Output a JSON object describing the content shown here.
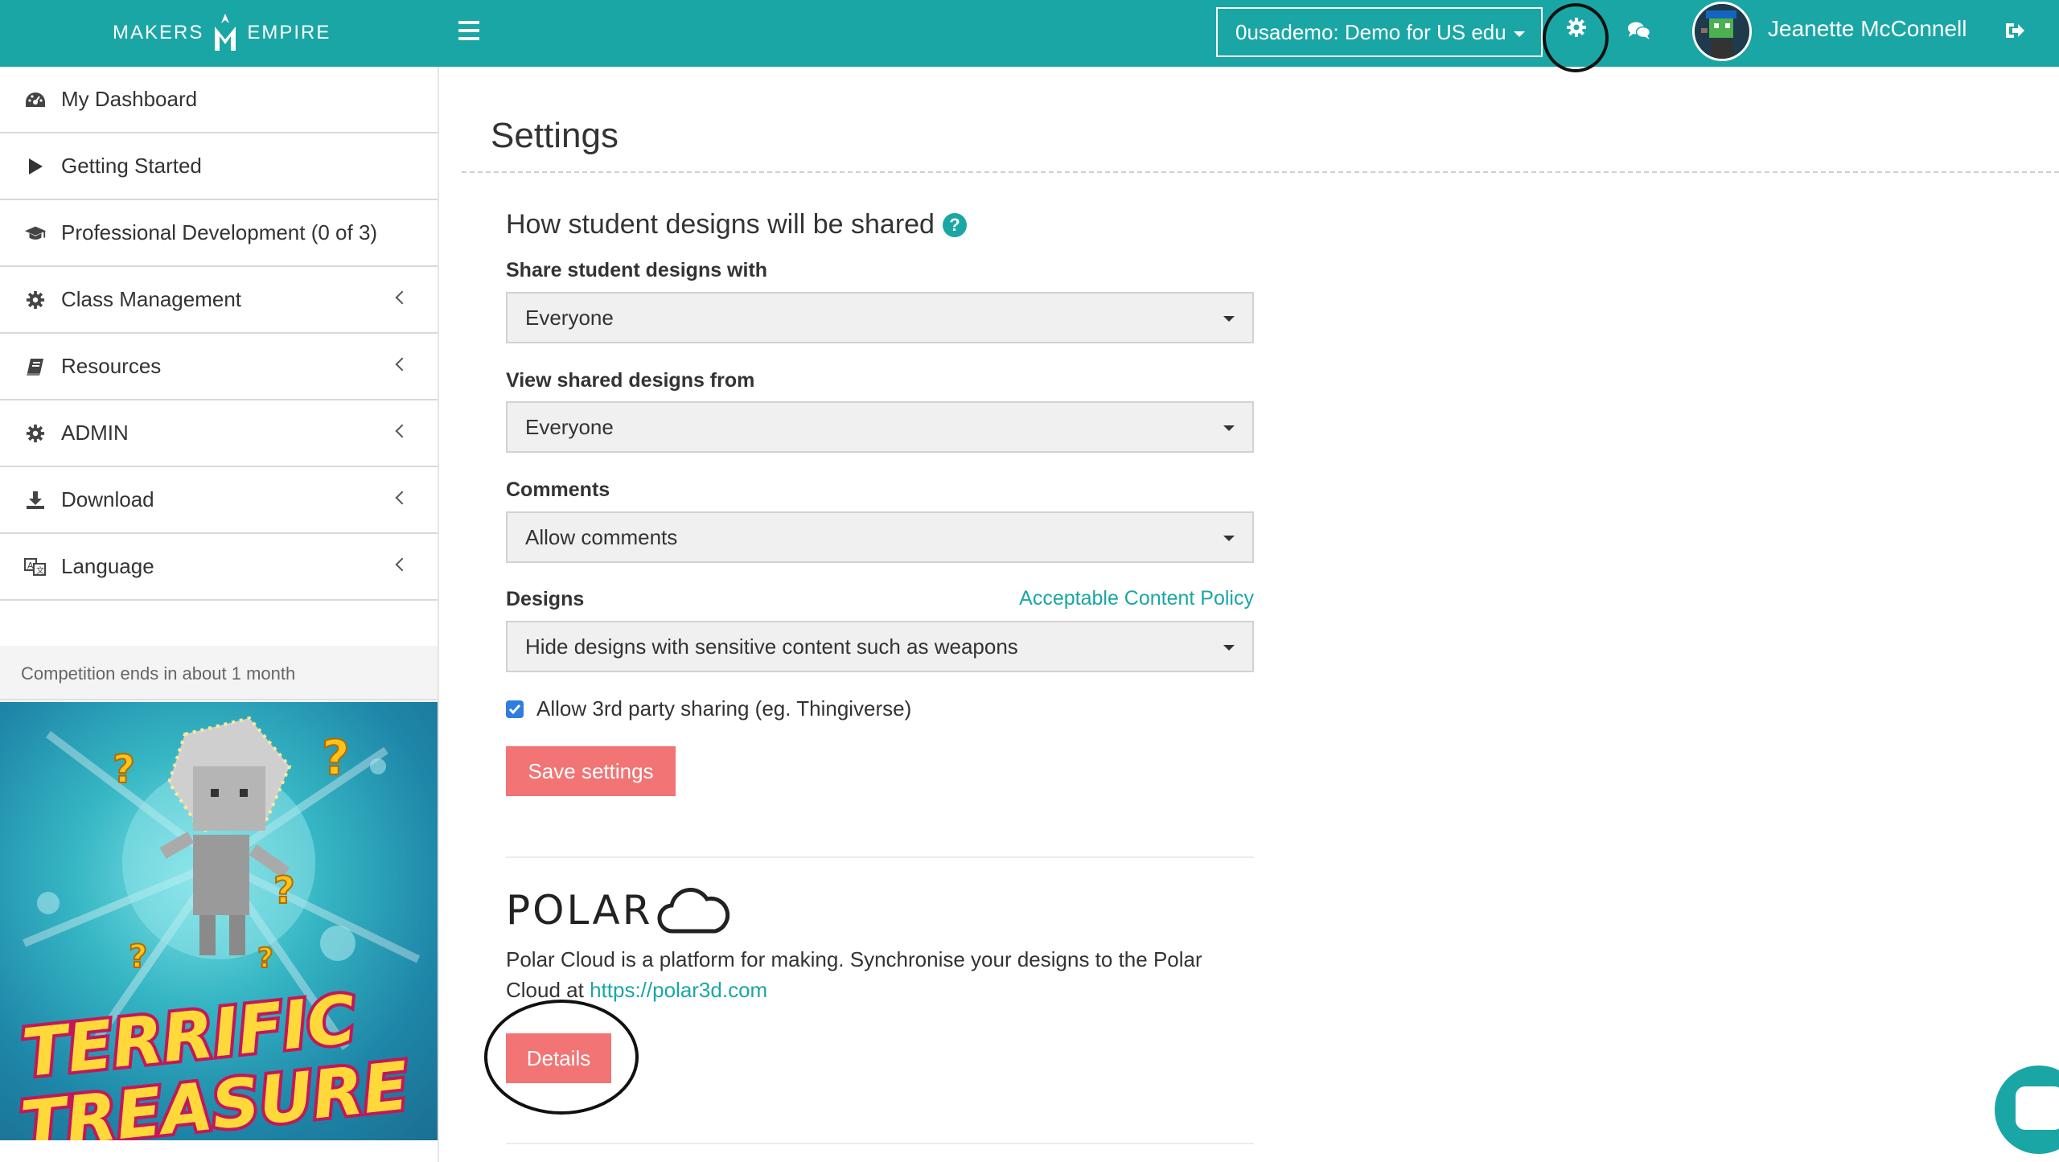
{
  "brand": {
    "left": "MAKERS",
    "right": "EMPIRE"
  },
  "header": {
    "school_select": "0usademo: Demo for US edu",
    "user_name": "Jeanette McConnell"
  },
  "sidebar": {
    "items": [
      {
        "label": "My Dashboard",
        "icon": "dashboard-icon"
      },
      {
        "label": "Getting Started",
        "icon": "play-icon"
      },
      {
        "label": "Professional Development (0 of 3)",
        "icon": "graduation-cap-icon"
      },
      {
        "label": "Class Management",
        "icon": "gear-icon"
      },
      {
        "label": "Resources",
        "icon": "book-icon"
      },
      {
        "label": "ADMIN",
        "icon": "gear-icon"
      },
      {
        "label": "Download",
        "icon": "download-icon"
      },
      {
        "label": "Language",
        "icon": "language-icon"
      }
    ],
    "competition_note": "Competition ends in about 1 month",
    "promo": {
      "line1": "TERRIFIC",
      "line2": "TREASURE"
    }
  },
  "main": {
    "title": "Settings",
    "section_heading": "How student designs will be shared",
    "share_label": "Share student designs with",
    "share_value": "Everyone",
    "view_label": "View shared designs from",
    "view_value": "Everyone",
    "comments_label": "Comments",
    "comments_value": "Allow comments",
    "designs_label": "Designs",
    "policy_link": "Acceptable Content Policy",
    "designs_value": "Hide designs with sensitive content such as weapons",
    "third_party_label": "Allow 3rd party sharing (eg. Thingiverse)",
    "third_party_checked": true,
    "save_button": "Save settings",
    "polar": {
      "logo_text": "POLAR",
      "desc_prefix": "Polar Cloud is a platform for making. Synchronise your designs to the Polar Cloud at ",
      "link": "https://polar3d.com",
      "details_button": "Details"
    }
  },
  "colors": {
    "brand": "#1ba6a6",
    "button": "#f27474",
    "checkbox": "#2f7de1"
  }
}
